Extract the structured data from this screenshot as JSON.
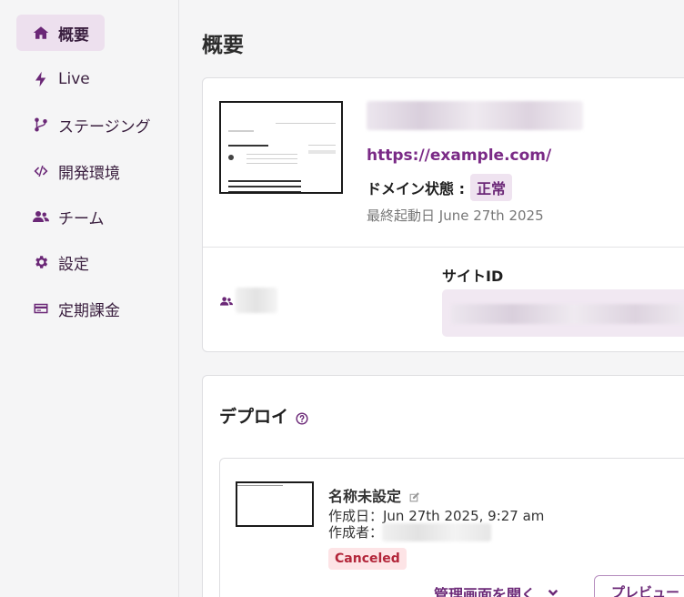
{
  "sidebar": {
    "items": [
      {
        "label": "概要",
        "icon": "home-icon",
        "active": true
      },
      {
        "label": "Live",
        "icon": "bolt-icon",
        "active": false
      },
      {
        "label": "ステージング",
        "icon": "branch-icon",
        "active": false
      },
      {
        "label": "開発環境",
        "icon": "code-icon",
        "active": false
      },
      {
        "label": "チーム",
        "icon": "users-icon",
        "active": false
      },
      {
        "label": "設定",
        "icon": "gear-icon",
        "active": false
      },
      {
        "label": "定期課金",
        "icon": "credit-card-icon",
        "active": false
      }
    ]
  },
  "main": {
    "page_title": "概要",
    "site": {
      "url": "https://example.com/",
      "domain_status_label": "ドメイン状態 :",
      "domain_status_value": "正常",
      "last_started": "最終起動日 June 27th 2025",
      "site_id_label": "サイトID"
    },
    "deploy": {
      "title": "デプロイ",
      "item": {
        "name": "名称未設定",
        "created": "作成日：Jun 27th 2025, 9:27 am",
        "author_label": "作成者：",
        "status": "Canceled",
        "open_admin_label": "管理画面を開く",
        "preview_label": "プレビュー"
      }
    }
  },
  "colors": {
    "accent": "#6b2877",
    "link": "#7a2a86",
    "badge_bg": "#efe3f0",
    "canceled_bg": "#fde4e6",
    "canceled_text": "#b3263a"
  }
}
